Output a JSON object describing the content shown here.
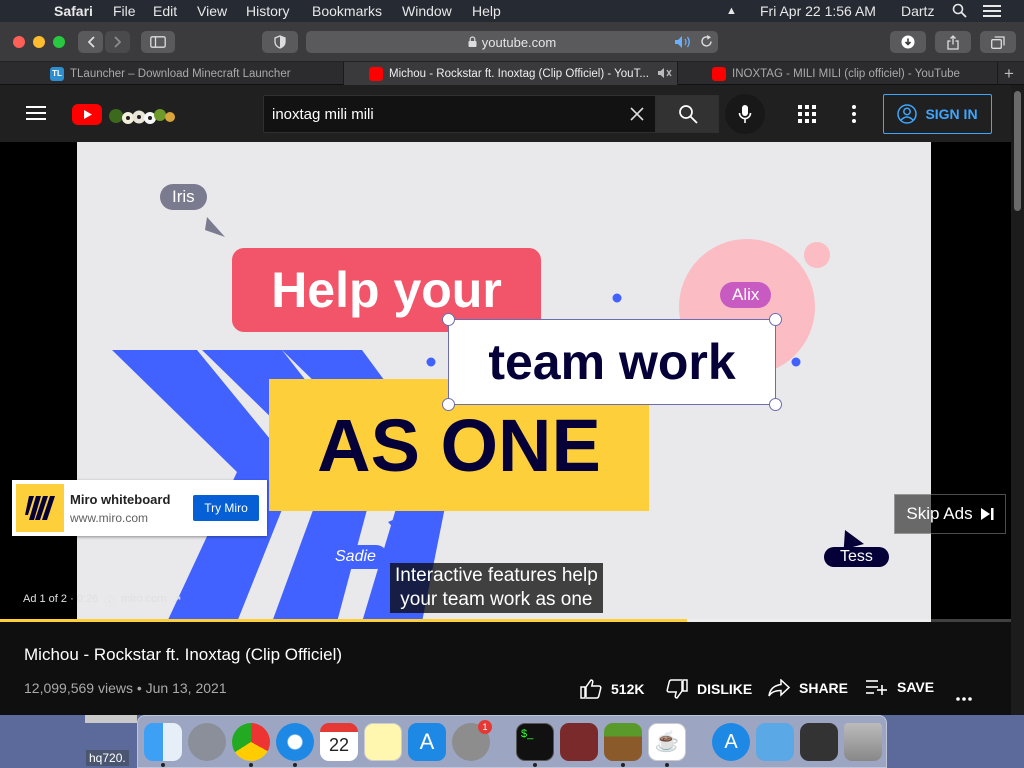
{
  "menubar": {
    "app": "Safari",
    "items": [
      "File",
      "Edit",
      "View",
      "History",
      "Bookmarks",
      "Window",
      "Help"
    ],
    "datetime": "Fri Apr 22  1:56 AM",
    "user": "Dartz"
  },
  "toolbar": {
    "url": "youtube.com"
  },
  "tabs": [
    {
      "label": "TLauncher – Download Minecraft Launcher",
      "icon": "tlauncher-icon"
    },
    {
      "label": "Michou - Rockstar ft. Inoxtag (Clip Officiel) - YouT...",
      "icon": "youtube-icon",
      "active": true
    },
    {
      "label": "INOXTAG - MILI MILI (clip officiel) - YouTube",
      "icon": "youtube-icon"
    }
  ],
  "youtube": {
    "search_value": "inoxtag mili mili",
    "sign_in": "SIGN IN"
  },
  "video": {
    "headline1": "Help your",
    "headline2": "team work",
    "headline3": "AS ONE",
    "cursor_names": [
      "Iris",
      "Alix",
      "Sadie",
      "Tess"
    ],
    "caption_line1": "Interactive features help",
    "caption_line2": "your team work as one",
    "ad_counter": "Ad 1 of 2 · 0:26",
    "ad_domain": "miro.com",
    "skip": "Skip Ads",
    "ad_card": {
      "title": "Miro whiteboard",
      "domain": "www.miro.com",
      "cta": "Try Miro"
    },
    "progress": 0.68
  },
  "info": {
    "title": "Michou - Rockstar ft. Inoxtag (Clip Officiel)",
    "views": "12,099,569 views • Jun 13, 2021",
    "likes": "512K",
    "dislike": "DISLIKE",
    "share": "SHARE",
    "save": "SAVE"
  },
  "dock": {
    "badge": "1",
    "desktop_label": "hq720."
  },
  "colors": {
    "accent": "#3ea6ff",
    "youtube_red": "#ff0000",
    "pink": "#f2556a",
    "yellow": "#fdd03b",
    "navy": "#050038",
    "blue": "#4262ff"
  }
}
